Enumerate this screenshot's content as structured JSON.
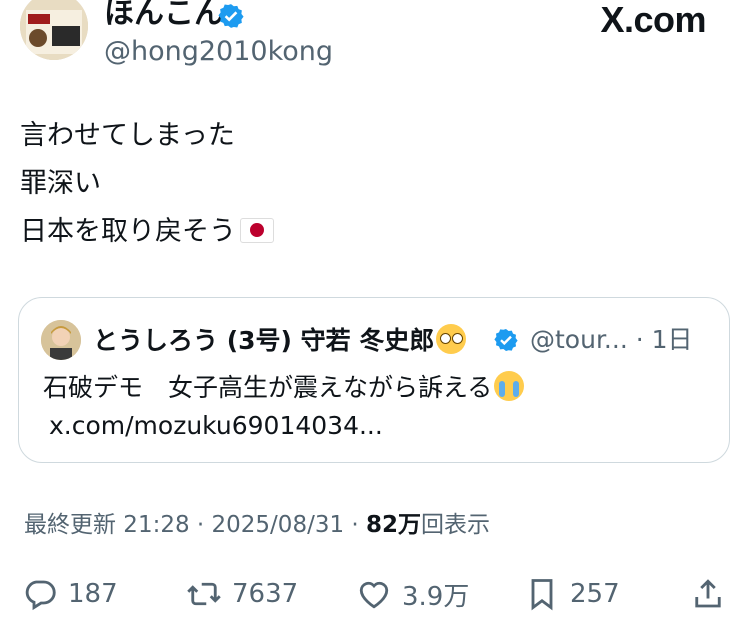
{
  "author": {
    "display_name": "ほんこん",
    "handle": "@hong2010kong",
    "verified": true
  },
  "brand": {
    "logo_text": ".com",
    "logo_glyph": "X"
  },
  "tweet": {
    "lines": [
      "言わせてしまった",
      "罪深い",
      "日本を取り戻そう"
    ],
    "flag_emoji": "japan-flag"
  },
  "quote": {
    "display_name": "とうしろう (3号) 守若 冬史郎",
    "handle_and_time": "@tour... · 1日",
    "text": "石破デモ　女子高生が震えながら訴える",
    "link": "x.com/mozuku69014034..."
  },
  "meta": {
    "updated": "最終更新 21:28 · 2025/08/31 · ",
    "views_count": "82万",
    "views_label": "回表示"
  },
  "actions": {
    "replies": "187",
    "reposts": "7637",
    "likes": "3.9万",
    "bookmarks": "257"
  },
  "colors": {
    "verified_blue": "#1d9bf0",
    "text_secondary": "#536471",
    "border": "#cfd9de"
  }
}
